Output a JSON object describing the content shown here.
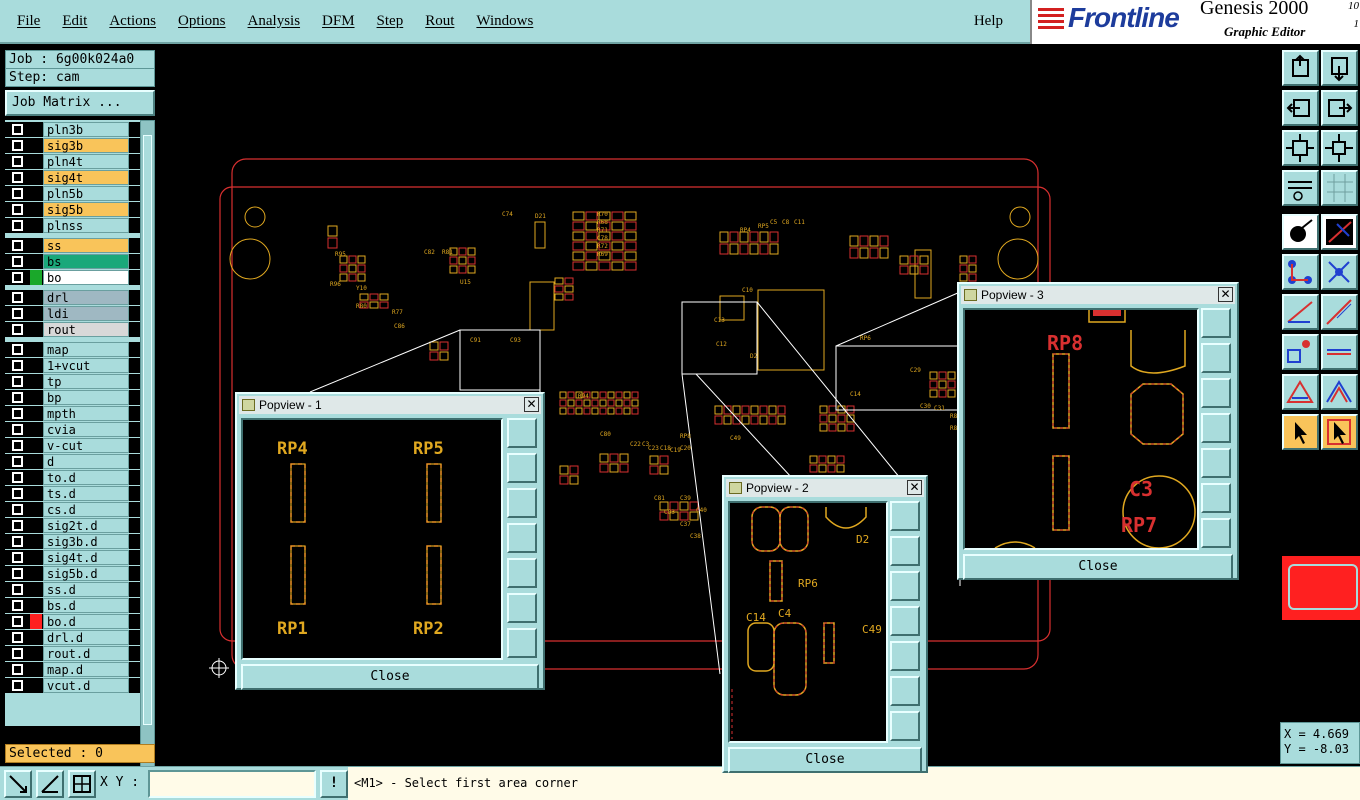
{
  "menubar": {
    "items": [
      "File",
      "Edit",
      "Actions",
      "Options",
      "Analysis",
      "DFM",
      "Step",
      "Rout",
      "Windows"
    ],
    "help": "Help"
  },
  "brand": {
    "logo": "Frontline",
    "title": "Genesis 2000",
    "subtitle": "Graphic Editor",
    "version_top": "10",
    "version_bottom": "1"
  },
  "job": {
    "job_label": "Job : 6g00k024a0",
    "step_label": "Step: cam",
    "matrix_button": "Job Matrix ..."
  },
  "layers": [
    {
      "name": "pln3b",
      "color": "#a9dcdc",
      "swatch": "#000"
    },
    {
      "name": "sig3b",
      "color": "#f9c45a",
      "swatch": "#000"
    },
    {
      "name": "pln4t",
      "color": "#a9dcdc",
      "swatch": "#000"
    },
    {
      "name": "sig4t",
      "color": "#f9c45a",
      "swatch": "#000"
    },
    {
      "name": "pln5b",
      "color": "#a9dcdc",
      "swatch": "#000"
    },
    {
      "name": "sig5b",
      "color": "#f9c45a",
      "swatch": "#000"
    },
    {
      "name": "plnss",
      "color": "#a9dcdc",
      "swatch": "#000"
    },
    {
      "name": "ss",
      "color": "#f9c45a",
      "swatch": "#000"
    },
    {
      "name": "bs",
      "color": "#1aa87a",
      "swatch": "#000"
    },
    {
      "name": "bo",
      "color": "#ffffff",
      "swatch": "#1aa82a"
    },
    {
      "name": "drl",
      "color": "#9fb8c2",
      "swatch": "#000"
    },
    {
      "name": "ldi",
      "color": "#9fb8c2",
      "swatch": "#000"
    },
    {
      "name": "rout",
      "color": "#d8d8d8",
      "swatch": "#000"
    },
    {
      "name": "map",
      "color": "#a9dcdc",
      "swatch": "#000"
    },
    {
      "name": "1+vcut",
      "color": "#a9dcdc",
      "swatch": "#000"
    },
    {
      "name": "tp",
      "color": "#a9dcdc",
      "swatch": "#000"
    },
    {
      "name": "bp",
      "color": "#a9dcdc",
      "swatch": "#000"
    },
    {
      "name": "mpth",
      "color": "#a9dcdc",
      "swatch": "#000"
    },
    {
      "name": "cvia",
      "color": "#a9dcdc",
      "swatch": "#000"
    },
    {
      "name": "v-cut",
      "color": "#a9dcdc",
      "swatch": "#000"
    },
    {
      "name": "d",
      "color": "#a9dcdc",
      "swatch": "#000"
    },
    {
      "name": "to.d",
      "color": "#a9dcdc",
      "swatch": "#000"
    },
    {
      "name": "ts.d",
      "color": "#a9dcdc",
      "swatch": "#000"
    },
    {
      "name": "cs.d",
      "color": "#a9dcdc",
      "swatch": "#000"
    },
    {
      "name": "sig2t.d",
      "color": "#a9dcdc",
      "swatch": "#000"
    },
    {
      "name": "sig3b.d",
      "color": "#a9dcdc",
      "swatch": "#000"
    },
    {
      "name": "sig4t.d",
      "color": "#a9dcdc",
      "swatch": "#000"
    },
    {
      "name": "sig5b.d",
      "color": "#a9dcdc",
      "swatch": "#000"
    },
    {
      "name": "ss.d",
      "color": "#a9dcdc",
      "swatch": "#000"
    },
    {
      "name": "bs.d",
      "color": "#a9dcdc",
      "swatch": "#000"
    },
    {
      "name": "bo.d",
      "color": "#a9dcdc",
      "swatch": "#ff2020"
    },
    {
      "name": "drl.d",
      "color": "#a9dcdc",
      "swatch": "#000"
    },
    {
      "name": "rout.d",
      "color": "#a9dcdc",
      "swatch": "#000"
    },
    {
      "name": "map.d",
      "color": "#a9dcdc",
      "swatch": "#000"
    },
    {
      "name": "vcut.d",
      "color": "#a9dcdc",
      "swatch": "#000"
    }
  ],
  "selected": "Selected : 0",
  "coords": {
    "x": "X = 4.669",
    "y": "Y = -8.03"
  },
  "bottom": {
    "xy_label": "X Y :",
    "xy_value": "",
    "message": "<M1> - Select first area corner",
    "exclaim": "!"
  },
  "popups": [
    {
      "title": "Popview - 1",
      "close": "Close",
      "labels": [
        "RP4",
        "RP5",
        "RP1",
        "RP2"
      ]
    },
    {
      "title": "Popview - 2",
      "close": "Close",
      "labels": [
        "D2",
        "RP6",
        "C4",
        "C14",
        "C49"
      ]
    },
    {
      "title": "Popview - 3",
      "close": "Close",
      "labels": [
        "RP8",
        "C3",
        "RP7"
      ]
    }
  ],
  "pcb_labels": [
    "R70",
    "R68",
    "R71",
    "C78",
    "R72",
    "R69",
    "D21",
    "C74",
    "U15",
    "R95",
    "R96",
    "Y10",
    "R80",
    "R77",
    "C86",
    "C82",
    "R81",
    "C91",
    "C93",
    "RP4",
    "RP5",
    "C5",
    "C8",
    "C11",
    "C10",
    "C13",
    "C12",
    "D2",
    "RP6",
    "C14",
    "C49",
    "RP8",
    "C3",
    "R94",
    "C80",
    "C22",
    "C23",
    "C18",
    "C19",
    "C20",
    "C29",
    "C30",
    "C31",
    "R84",
    "R85",
    "C39",
    "C40",
    "C81",
    "C83",
    "C37",
    "C38"
  ],
  "colors": {
    "ui": "#a9dcdc",
    "accent": "#f9c45a",
    "board": "#d83030",
    "copper": "#e0a820"
  }
}
